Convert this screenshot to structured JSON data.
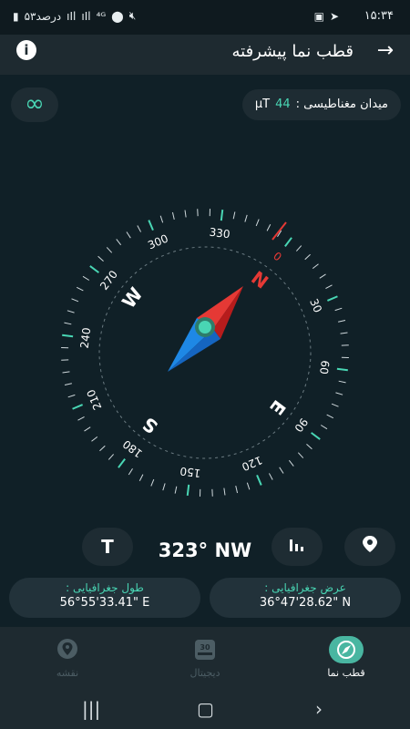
{
  "status": {
    "time": "۱۵:۳۴",
    "battery": "۵۳درصد"
  },
  "appbar": {
    "title": "قطب نما پیشرفته",
    "back_icon": "arrow-right",
    "info_icon": "info"
  },
  "magnetic": {
    "label": "میدان مغناطیسی :",
    "value": "44",
    "unit": "μT"
  },
  "compass": {
    "heading_deg": 323,
    "cardinals": [
      "N",
      "E",
      "S",
      "W"
    ],
    "degree_labels": [
      "0",
      "30",
      "60",
      "90",
      "120",
      "150",
      "180",
      "210",
      "240",
      "270",
      "300",
      "330"
    ],
    "accent": "#49d6b4",
    "north_color": "#e53935",
    "south_color": "#1e88e5"
  },
  "controls": {
    "true_north_label": "T",
    "heading_text": "323° NW"
  },
  "coords": {
    "longitude_label": "طول جغرافیایی :",
    "longitude_value": "56°55'33.41\" E",
    "latitude_label": "عرض جغرافیایی :",
    "latitude_value": "36°47'28.62\" N"
  },
  "nav": {
    "items": [
      {
        "label": "قطب نما",
        "icon": "compass"
      },
      {
        "label": "دیجیتال",
        "icon": "digital-30"
      },
      {
        "label": "نقشه",
        "icon": "map-pin"
      }
    ]
  }
}
